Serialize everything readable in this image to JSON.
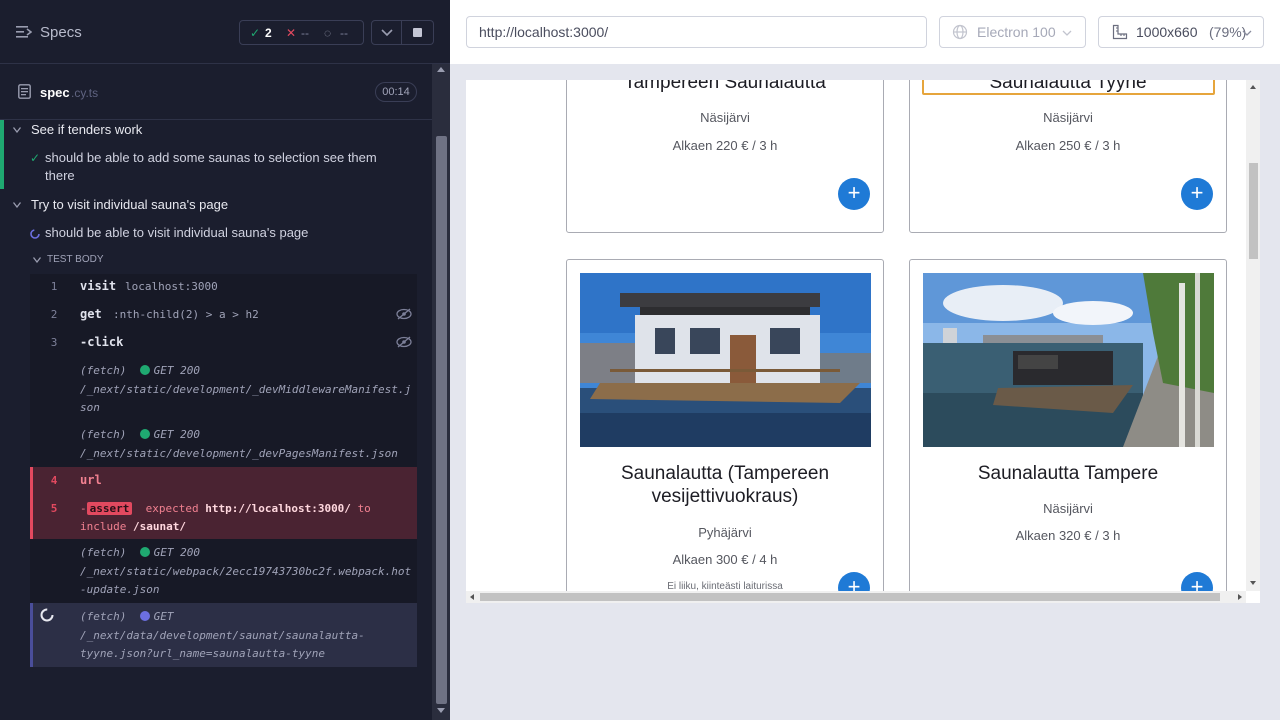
{
  "reporter": {
    "title": "Specs",
    "stats": {
      "passed": "2",
      "failed": "--",
      "pending": "--"
    },
    "spec": {
      "name": "spec",
      "ext": ".cy.ts",
      "duration": "00:14"
    },
    "suites": [
      {
        "title": "See if tenders work",
        "tests": [
          {
            "title_line1": "should be able to add some saunas to selection see them",
            "title_line2": "there"
          }
        ]
      },
      {
        "title": "Try to visit individual sauna's page",
        "tests": [
          {
            "title": "should be able to visit individual sauna's page"
          }
        ]
      }
    ],
    "test_body_label": "TEST BODY",
    "commands": [
      {
        "num": "1",
        "name": "visit",
        "message": "localhost:3000"
      },
      {
        "num": "2",
        "name": "get",
        "message": ":nth-child(2) > a > h2"
      },
      {
        "num": "3",
        "name": "-click",
        "message": ""
      }
    ],
    "fetches": [
      {
        "label": "(fetch)",
        "method": "GET 200",
        "path_line1": "/_next/static/development/_devMiddlewareManifest.j",
        "path_line2": "son"
      },
      {
        "label": "(fetch)",
        "method": "GET 200",
        "path_line1": "/_next/static/development/_devPagesManifest.json",
        "path_line2": ""
      }
    ],
    "error_commands": [
      {
        "num": "4",
        "name": "url"
      },
      {
        "num": "5",
        "prefix": "-",
        "badge": "assert",
        "expected": "expected",
        "url": "http://localhost:3000/",
        "to": "to",
        "include": "include",
        "target": "/saunat/"
      }
    ],
    "fetch3": {
      "label": "(fetch)",
      "method": "GET 200",
      "path_line1": "/_next/static/webpack/2ecc19743730bc2f.webpack.hot",
      "path_line2": "-update.json"
    },
    "fetch4": {
      "label": "(fetch)",
      "method": "GET",
      "path_line1": "/_next/data/development/saunat/saunalautta-",
      "path_line2": "tyyne.json?url_name=saunalautta-tyyne"
    }
  },
  "aut": {
    "url": "http://localhost:3000/",
    "browser": "Electron 100",
    "viewport": "1000x660",
    "zoom": "(79%)"
  },
  "cards": [
    {
      "title": "Tampereen Saunalautta",
      "location": "Näsijärvi",
      "price": "Alkaen 220 € / 3 h"
    },
    {
      "title": "Saunalautta Tyyne",
      "location": "Näsijärvi",
      "price": "Alkaen 250 € / 3 h"
    },
    {
      "title_line1": "Saunalautta (Tampereen",
      "title_line2": "vesijettivuokraus)",
      "location": "Pyhäjärvi",
      "price": "Alkaen 300 € / 4 h",
      "desc": "Ei liiku, kiinteästi laiturissa"
    },
    {
      "title": "Saunalautta Tampere",
      "location": "Näsijärvi",
      "price": "Alkaen 320 € / 3 h"
    }
  ],
  "add_symbol": "+",
  "colors": {
    "pass": "#1fa971",
    "fail": "#e2495f",
    "accent": "#1f7ad6",
    "pending": "#6c6fe0"
  },
  "icons": [
    "specs-icon",
    "check-icon",
    "x-icon",
    "spinner-icon",
    "chevron-down-icon",
    "stop-icon",
    "file-icon",
    "eye-slash-icon",
    "globe-icon",
    "ruler-icon"
  ]
}
